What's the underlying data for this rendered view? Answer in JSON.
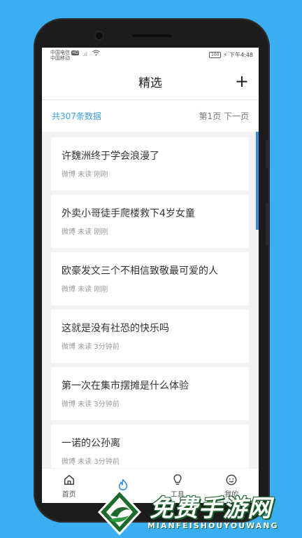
{
  "statusbar": {
    "carrier1": "中国电信",
    "hd": "HD",
    "carrier2": "中国移动",
    "battery": "100",
    "time": "下午4:48"
  },
  "header": {
    "title": "精选",
    "add_label": "+"
  },
  "subbar": {
    "count": "共307条数据",
    "page": "第1页",
    "next": "下一页"
  },
  "items": [
    {
      "title": "许魏洲终于学会浪漫了",
      "meta": "微博 未读 刚刚"
    },
    {
      "title": "外卖小哥徒手爬楼救下4岁女童",
      "meta": "微博 未读 刚刚"
    },
    {
      "title": "欧豪发文三个不相信致敬最可爱的人",
      "meta": "微博 未读 刚刚"
    },
    {
      "title": "这就是没有社恐的快乐吗",
      "meta": "微博 未读 3分钟前"
    },
    {
      "title": "第一次在集市摆摊是什么体验",
      "meta": "微博 未读 3分钟前"
    },
    {
      "title": "一诺的公孙离",
      "meta": "微博 未读 3分钟前"
    }
  ],
  "tabs": [
    {
      "label": "首页",
      "icon": "home-icon"
    },
    {
      "label": "",
      "icon": "flame-icon"
    },
    {
      "label": "工具",
      "icon": "bulb-icon"
    },
    {
      "label": "我的",
      "icon": "smile-icon"
    }
  ],
  "watermark": {
    "cn": "免费手游网",
    "en": "MIANFEISHOUYOUWANG"
  },
  "colors": {
    "background": "#3aaef0",
    "accent": "#3a8ee0",
    "count": "#3aa0e8"
  }
}
